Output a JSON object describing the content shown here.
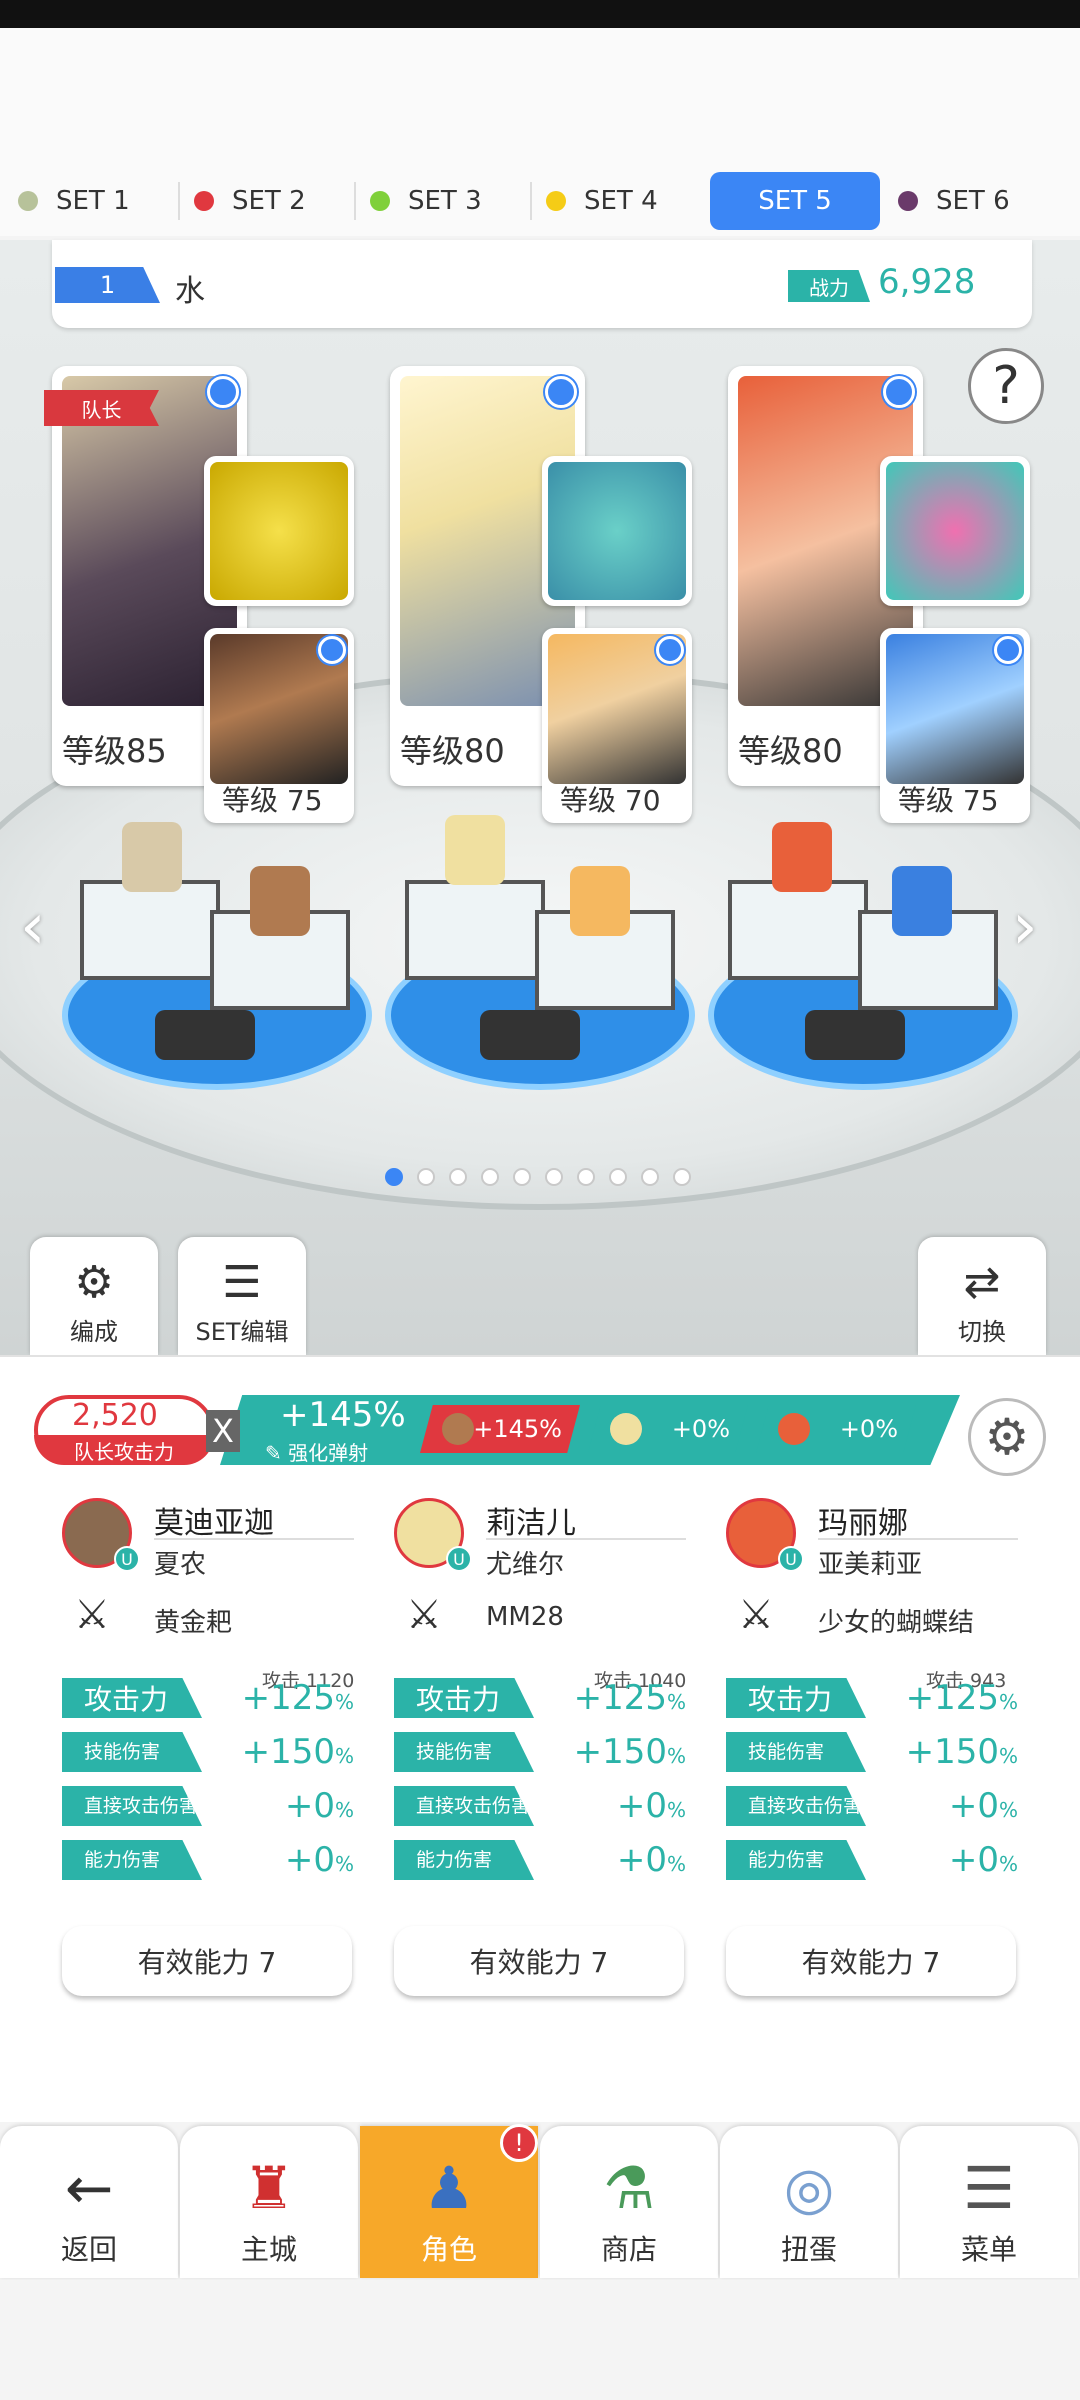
{
  "set_tabs": [
    {
      "label": "SET 1",
      "color": "#b7c29a",
      "active": false
    },
    {
      "label": "SET 2",
      "color": "#e0383f",
      "active": false
    },
    {
      "label": "SET 3",
      "color": "#7fd03a",
      "active": false
    },
    {
      "label": "SET 4",
      "color": "#f5cc16",
      "active": false
    },
    {
      "label": "SET 5",
      "color": "#ffffff",
      "active": true
    },
    {
      "label": "SET 6",
      "color": "#6a3a6a",
      "active": false
    }
  ],
  "team": {
    "number": "1",
    "name": "水",
    "power_label": "战力",
    "power_value": "6,928"
  },
  "help_icon": "?",
  "heroes": [
    {
      "captain_label": "队长",
      "level": "等级85",
      "sub_level": "等级 75"
    },
    {
      "level": "等级80",
      "sub_level": "等级 70"
    },
    {
      "level": "等级80",
      "sub_level": "等级 75"
    }
  ],
  "pager": {
    "total": 10,
    "current": 1
  },
  "formation_buttons": {
    "edit": "编成",
    "set_edit": "SET编辑",
    "switch": "切换"
  },
  "captain_attack": {
    "value": "2,520",
    "label": "队长攻击力",
    "x": "X"
  },
  "buff": {
    "value": "+145%",
    "label": "强化弹射"
  },
  "chips": [
    {
      "value": "+145%",
      "color": "#e0383f"
    },
    {
      "value": "+0%",
      "color": "#2bb3a8"
    },
    {
      "value": "+0%",
      "color": "#2bb3a8"
    }
  ],
  "columns": [
    {
      "name": "莫迪亚迦",
      "sub": "夏农",
      "weapon": "黄金耙",
      "atk_header": "攻击 1120",
      "stats": [
        {
          "label": "攻击力",
          "value": "+125",
          "unit": "%"
        },
        {
          "label": "技能伤害",
          "value": "+150",
          "unit": "%"
        },
        {
          "label": "直接攻击伤害",
          "value": "+0",
          "unit": "%"
        },
        {
          "label": "能力伤害",
          "value": "+0",
          "unit": "%"
        }
      ],
      "effect": "有效能力 7"
    },
    {
      "name": "莉洁儿",
      "sub": "尤维尔",
      "weapon": "MM28",
      "atk_header": "攻击 1040",
      "stats": [
        {
          "label": "攻击力",
          "value": "+125",
          "unit": "%"
        },
        {
          "label": "技能伤害",
          "value": "+150",
          "unit": "%"
        },
        {
          "label": "直接攻击伤害",
          "value": "+0",
          "unit": "%"
        },
        {
          "label": "能力伤害",
          "value": "+0",
          "unit": "%"
        }
      ],
      "effect": "有效能力 7"
    },
    {
      "name": "玛丽娜",
      "sub": "亚美莉亚",
      "weapon": "少女的蝴蝶结",
      "atk_header": "攻击  943",
      "stats": [
        {
          "label": "攻击力",
          "value": "+125",
          "unit": "%"
        },
        {
          "label": "技能伤害",
          "value": "+150",
          "unit": "%"
        },
        {
          "label": "直接攻击伤害",
          "value": "+0",
          "unit": "%"
        },
        {
          "label": "能力伤害",
          "value": "+0",
          "unit": "%"
        }
      ],
      "effect": "有效能力 7"
    }
  ],
  "nav": [
    {
      "label": "返回",
      "icon": "back-arrow-icon"
    },
    {
      "label": "主城",
      "icon": "castle-icon"
    },
    {
      "label": "角色",
      "icon": "hero-icon",
      "active": true,
      "badge": "!"
    },
    {
      "label": "商店",
      "icon": "shop-icon"
    },
    {
      "label": "扭蛋",
      "icon": "gacha-icon"
    },
    {
      "label": "菜单",
      "icon": "menu-icon"
    }
  ]
}
